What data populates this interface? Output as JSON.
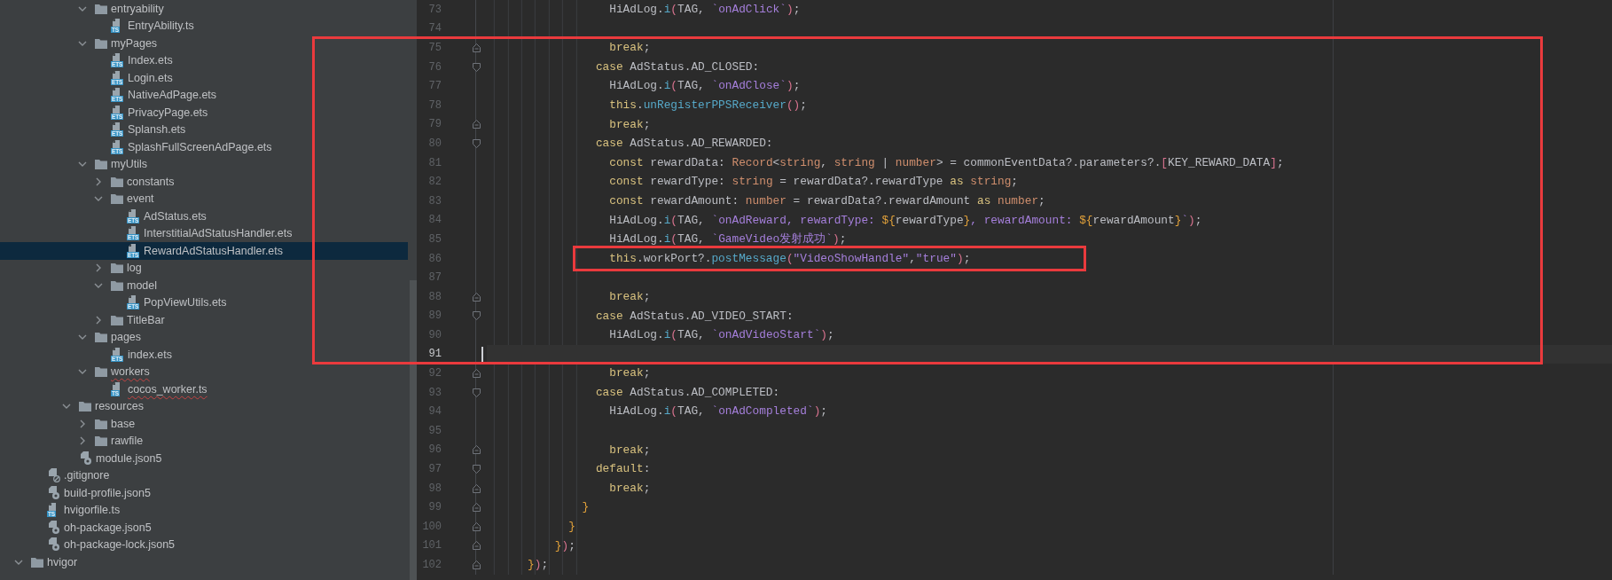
{
  "project_tree": {
    "items": [
      {
        "children": [
          {
            "children": [
              {
                "children": [
                  {
                    "children": [
                      {
                        "label": "entryability",
                        "kind": "folder",
                        "expanded": true,
                        "selected": false,
                        "misspelled": false,
                        "children": [
                          {
                            "label": "EntryAbility.ts",
                            "kind": "code_file",
                            "badge": "TS",
                            "selected": false,
                            "misspelled": false
                          }
                        ]
                      },
                      {
                        "label": "myPages",
                        "kind": "folder",
                        "expanded": true,
                        "selected": false,
                        "misspelled": false,
                        "children": [
                          {
                            "label": "Index.ets",
                            "kind": "code_file",
                            "badge": "ETS",
                            "selected": false,
                            "misspelled": false
                          },
                          {
                            "label": "Login.ets",
                            "kind": "code_file",
                            "badge": "ETS",
                            "selected": false,
                            "misspelled": false
                          },
                          {
                            "label": "NativeAdPage.ets",
                            "kind": "code_file",
                            "badge": "ETS",
                            "selected": false,
                            "misspelled": false
                          },
                          {
                            "label": "PrivacyPage.ets",
                            "kind": "code_file",
                            "badge": "ETS",
                            "selected": false,
                            "misspelled": false
                          },
                          {
                            "label": "Splansh.ets",
                            "kind": "code_file",
                            "badge": "ETS",
                            "selected": false,
                            "misspelled": false
                          },
                          {
                            "label": "SplashFullScreenAdPage.ets",
                            "kind": "code_file",
                            "badge": "ETS",
                            "selected": false,
                            "misspelled": false
                          }
                        ]
                      },
                      {
                        "label": "myUtils",
                        "kind": "folder",
                        "expanded": true,
                        "selected": false,
                        "misspelled": false,
                        "children": [
                          {
                            "label": "constants",
                            "kind": "folder",
                            "expanded": false,
                            "selected": false,
                            "misspelled": false
                          },
                          {
                            "label": "event",
                            "kind": "folder",
                            "expanded": true,
                            "selected": false,
                            "misspelled": false,
                            "children": [
                              {
                                "label": "AdStatus.ets",
                                "kind": "code_file",
                                "badge": "ETS",
                                "selected": false,
                                "misspelled": false
                              },
                              {
                                "label": "InterstitialAdStatusHandler.ets",
                                "kind": "code_file",
                                "badge": "ETS",
                                "selected": false,
                                "misspelled": false
                              },
                              {
                                "label": "RewardAdStatusHandler.ets",
                                "kind": "code_file",
                                "badge": "ETS",
                                "selected": true,
                                "misspelled": false
                              }
                            ]
                          },
                          {
                            "label": "log",
                            "kind": "folder",
                            "expanded": false,
                            "selected": false,
                            "misspelled": false
                          },
                          {
                            "label": "model",
                            "kind": "folder",
                            "expanded": true,
                            "selected": false,
                            "misspelled": false,
                            "children": [
                              {
                                "label": "PopViewUtils.ets",
                                "kind": "code_file",
                                "badge": "ETS",
                                "selected": false,
                                "misspelled": false
                              }
                            ]
                          },
                          {
                            "label": "TitleBar",
                            "kind": "folder",
                            "expanded": false,
                            "selected": false,
                            "misspelled": false
                          }
                        ]
                      },
                      {
                        "label": "pages",
                        "kind": "folder",
                        "expanded": true,
                        "selected": false,
                        "misspelled": false,
                        "children": [
                          {
                            "label": "index.ets",
                            "kind": "code_file",
                            "badge": "ETS",
                            "selected": false,
                            "misspelled": false
                          }
                        ]
                      },
                      {
                        "label": "workers",
                        "kind": "folder",
                        "expanded": true,
                        "selected": false,
                        "misspelled": true,
                        "children": [
                          {
                            "label": "cocos_worker.ts",
                            "kind": "code_file",
                            "badge": "TS",
                            "selected": false,
                            "misspelled": true
                          }
                        ]
                      }
                    ]
                  },
                  {
                    "label": "resources",
                    "kind": "folder",
                    "expanded": true,
                    "selected": false,
                    "misspelled": false,
                    "children": [
                      {
                        "label": "base",
                        "kind": "folder",
                        "expanded": false,
                        "selected": false,
                        "misspelled": false
                      },
                      {
                        "label": "rawfile",
                        "kind": "folder",
                        "expanded": false,
                        "selected": false,
                        "misspelled": false
                      }
                    ]
                  },
                  {
                    "label": "module.json5",
                    "kind": "config_file",
                    "selected": false,
                    "misspelled": false
                  }
                ]
              }
            ]
          },
          {
            "label": ".gitignore",
            "kind": "ignore_file",
            "selected": false,
            "misspelled": false
          },
          {
            "label": "build-profile.json5",
            "kind": "config_file",
            "selected": false,
            "misspelled": false
          },
          {
            "label": "hvigorfile.ts",
            "kind": "code_file",
            "badge": "TS",
            "selected": false,
            "misspelled": false
          },
          {
            "label": "oh-package.json5",
            "kind": "config_file",
            "selected": false,
            "misspelled": false
          },
          {
            "label": "oh-package-lock.json5",
            "kind": "config_file",
            "selected": false,
            "misspelled": false
          }
        ]
      },
      {
        "label": "hvigor",
        "kind": "folder",
        "expanded": true,
        "selected": false,
        "misspelled": false
      }
    ]
  },
  "editor": {
    "lines": [
      {
        "number": "73",
        "kind": "code",
        "current": false,
        "tokens": [
          {
            "text": "                  HiAdLog.",
            "kind": "plain"
          },
          {
            "text": "i",
            "kind": "call"
          },
          {
            "text": "(",
            "kind": "bracket"
          },
          {
            "text": "TAG, ",
            "kind": "plain"
          },
          {
            "text": "`onAdClick`",
            "kind": "string"
          },
          {
            "text": ")",
            "kind": "bracket"
          },
          {
            "text": ";",
            "kind": "plain"
          }
        ]
      },
      {
        "number": "74",
        "kind": "code",
        "current": false
      },
      {
        "number": "75",
        "kind": "fold_end",
        "current": false,
        "tokens": [
          {
            "text": "                  break",
            "kind": "keyword"
          },
          {
            "text": ";",
            "kind": "plain"
          }
        ]
      },
      {
        "number": "76",
        "kind": "fold_start",
        "current": false,
        "tokens": [
          {
            "text": "                case",
            "kind": "keyword"
          },
          {
            "text": " AdStatus.AD_CLOSED:",
            "kind": "plain"
          }
        ]
      },
      {
        "number": "77",
        "kind": "code",
        "current": false,
        "tokens": [
          {
            "text": "                  HiAdLog.",
            "kind": "plain"
          },
          {
            "text": "i",
            "kind": "call"
          },
          {
            "text": "(",
            "kind": "bracket"
          },
          {
            "text": "TAG, ",
            "kind": "plain"
          },
          {
            "text": "`onAdClose`",
            "kind": "string"
          },
          {
            "text": ")",
            "kind": "bracket"
          },
          {
            "text": ";",
            "kind": "plain"
          }
        ]
      },
      {
        "number": "78",
        "kind": "code",
        "current": false,
        "tokens": [
          {
            "text": "                  this",
            "kind": "keyword"
          },
          {
            "text": ".",
            "kind": "plain"
          },
          {
            "text": "unRegisterPPSReceiver",
            "kind": "call"
          },
          {
            "text": "()",
            "kind": "bracket"
          },
          {
            "text": ";",
            "kind": "plain"
          }
        ]
      },
      {
        "number": "79",
        "kind": "fold_end",
        "current": false,
        "tokens": [
          {
            "text": "                  break",
            "kind": "keyword"
          },
          {
            "text": ";",
            "kind": "plain"
          }
        ]
      },
      {
        "number": "80",
        "kind": "fold_start",
        "current": false,
        "tokens": [
          {
            "text": "                case",
            "kind": "keyword"
          },
          {
            "text": " AdStatus.AD_REWARDED:",
            "kind": "plain"
          }
        ]
      },
      {
        "number": "81",
        "kind": "code",
        "current": false,
        "tokens": [
          {
            "text": "                  const",
            "kind": "keyword"
          },
          {
            "text": " rewardData: ",
            "kind": "plain"
          },
          {
            "text": "Record",
            "kind": "type"
          },
          {
            "text": "<",
            "kind": "plain"
          },
          {
            "text": "string",
            "kind": "type"
          },
          {
            "text": ", ",
            "kind": "plain"
          },
          {
            "text": "string",
            "kind": "type"
          },
          {
            "text": " | ",
            "kind": "plain"
          },
          {
            "text": "number",
            "kind": "type"
          },
          {
            "text": "> = commonEventData?.parameters?.",
            "kind": "plain"
          },
          {
            "text": "[",
            "kind": "bracket"
          },
          {
            "text": "KEY_REWARD_DATA",
            "kind": "plain"
          },
          {
            "text": "]",
            "kind": "bracket"
          },
          {
            "text": ";",
            "kind": "plain"
          }
        ]
      },
      {
        "number": "82",
        "kind": "code",
        "current": false,
        "tokens": [
          {
            "text": "                  const",
            "kind": "keyword"
          },
          {
            "text": " rewardType: ",
            "kind": "plain"
          },
          {
            "text": "string",
            "kind": "type"
          },
          {
            "text": " = rewardData?.rewardType ",
            "kind": "plain"
          },
          {
            "text": "as ",
            "kind": "keyword"
          },
          {
            "text": "string",
            "kind": "type"
          },
          {
            "text": ";",
            "kind": "plain"
          }
        ]
      },
      {
        "number": "83",
        "kind": "code",
        "current": false,
        "tokens": [
          {
            "text": "                  const",
            "kind": "keyword"
          },
          {
            "text": " rewardAmount: ",
            "kind": "plain"
          },
          {
            "text": "number",
            "kind": "type"
          },
          {
            "text": " = rewardData?.rewardAmount ",
            "kind": "plain"
          },
          {
            "text": "as ",
            "kind": "keyword"
          },
          {
            "text": "number",
            "kind": "type"
          },
          {
            "text": ";",
            "kind": "plain"
          }
        ]
      },
      {
        "number": "84",
        "kind": "code",
        "current": false,
        "tokens": [
          {
            "text": "                  HiAdLog.",
            "kind": "plain"
          },
          {
            "text": "i",
            "kind": "call"
          },
          {
            "text": "(",
            "kind": "bracket"
          },
          {
            "text": "TAG, ",
            "kind": "plain"
          },
          {
            "text": "`onAdReward, rewardType: ",
            "kind": "string"
          },
          {
            "text": "${",
            "kind": "brace"
          },
          {
            "text": "rewardType",
            "kind": "plain"
          },
          {
            "text": "}",
            "kind": "brace"
          },
          {
            "text": ", rewardAmount: ",
            "kind": "string"
          },
          {
            "text": "${",
            "kind": "brace"
          },
          {
            "text": "rewardAmount",
            "kind": "plain"
          },
          {
            "text": "}",
            "kind": "brace"
          },
          {
            "text": "`",
            "kind": "string"
          },
          {
            "text": ")",
            "kind": "bracket"
          },
          {
            "text": ";",
            "kind": "plain"
          }
        ]
      },
      {
        "number": "85",
        "kind": "code",
        "current": false,
        "tokens": [
          {
            "text": "                  HiAdLog.",
            "kind": "plain"
          },
          {
            "text": "i",
            "kind": "call"
          },
          {
            "text": "(",
            "kind": "bracket"
          },
          {
            "text": "TAG, ",
            "kind": "plain"
          },
          {
            "text": "`GameVideo发射成功`",
            "kind": "string"
          },
          {
            "text": ")",
            "kind": "bracket"
          },
          {
            "text": ";",
            "kind": "plain"
          }
        ]
      },
      {
        "number": "86",
        "kind": "code",
        "current": false,
        "tokens": [
          {
            "text": "                  this",
            "kind": "keyword"
          },
          {
            "text": ".workPort?.",
            "kind": "plain"
          },
          {
            "text": "postMessage",
            "kind": "call"
          },
          {
            "text": "(",
            "kind": "bracket"
          },
          {
            "text": "\"VideoShowHandle\"",
            "kind": "string"
          },
          {
            "text": ",",
            "kind": "plain"
          },
          {
            "text": "\"true\"",
            "kind": "string"
          },
          {
            "text": ")",
            "kind": "bracket"
          },
          {
            "text": ";",
            "kind": "plain"
          }
        ]
      },
      {
        "number": "87",
        "kind": "code",
        "current": false
      },
      {
        "number": "88",
        "kind": "fold_end",
        "current": false,
        "tokens": [
          {
            "text": "                  break",
            "kind": "keyword"
          },
          {
            "text": ";",
            "kind": "plain"
          }
        ]
      },
      {
        "number": "89",
        "kind": "fold_start",
        "current": false,
        "tokens": [
          {
            "text": "                case",
            "kind": "keyword"
          },
          {
            "text": " AdStatus.AD_VIDEO_START:",
            "kind": "plain"
          }
        ]
      },
      {
        "number": "90",
        "kind": "code",
        "current": false,
        "tokens": [
          {
            "text": "                  HiAdLog.",
            "kind": "plain"
          },
          {
            "text": "i",
            "kind": "call"
          },
          {
            "text": "(",
            "kind": "bracket"
          },
          {
            "text": "TAG, ",
            "kind": "plain"
          },
          {
            "text": "`onAdVideoStart`",
            "kind": "string"
          },
          {
            "text": ")",
            "kind": "bracket"
          },
          {
            "text": ";",
            "kind": "plain"
          }
        ]
      },
      {
        "number": "91",
        "kind": "code",
        "current": true
      },
      {
        "number": "92",
        "kind": "fold_end",
        "current": false,
        "tokens": [
          {
            "text": "                  break",
            "kind": "keyword"
          },
          {
            "text": ";",
            "kind": "plain"
          }
        ]
      },
      {
        "number": "93",
        "kind": "fold_start",
        "current": false,
        "tokens": [
          {
            "text": "                case",
            "kind": "keyword"
          },
          {
            "text": " AdStatus.AD_COMPLETED:",
            "kind": "plain"
          }
        ]
      },
      {
        "number": "94",
        "kind": "code",
        "current": false,
        "tokens": [
          {
            "text": "                  HiAdLog.",
            "kind": "plain"
          },
          {
            "text": "i",
            "kind": "call"
          },
          {
            "text": "(",
            "kind": "bracket"
          },
          {
            "text": "TAG, ",
            "kind": "plain"
          },
          {
            "text": "`onAdCompleted`",
            "kind": "string"
          },
          {
            "text": ")",
            "kind": "bracket"
          },
          {
            "text": ";",
            "kind": "plain"
          }
        ]
      },
      {
        "number": "95",
        "kind": "code",
        "current": false
      },
      {
        "number": "96",
        "kind": "fold_end",
        "current": false,
        "tokens": [
          {
            "text": "                  break",
            "kind": "keyword"
          },
          {
            "text": ";",
            "kind": "plain"
          }
        ]
      },
      {
        "number": "97",
        "kind": "fold_start",
        "current": false,
        "tokens": [
          {
            "text": "                default",
            "kind": "keyword"
          },
          {
            "text": ":",
            "kind": "plain"
          }
        ]
      },
      {
        "number": "98",
        "kind": "fold_end",
        "current": false,
        "tokens": [
          {
            "text": "                  break",
            "kind": "keyword"
          },
          {
            "text": ";",
            "kind": "plain"
          }
        ]
      },
      {
        "number": "99",
        "kind": "fold_end",
        "current": false,
        "tokens": [
          {
            "text": "              }",
            "kind": "brace"
          }
        ]
      },
      {
        "number": "100",
        "kind": "fold_end",
        "current": false,
        "tokens": [
          {
            "text": "            }",
            "kind": "brace"
          }
        ]
      },
      {
        "number": "101",
        "kind": "fold_end",
        "current": false,
        "tokens": [
          {
            "text": "          }",
            "kind": "brace"
          },
          {
            "text": ")",
            "kind": "bracket"
          },
          {
            "text": ";",
            "kind": "plain"
          }
        ]
      },
      {
        "number": "102",
        "kind": "fold_end",
        "current": false,
        "tokens": [
          {
            "text": "      }",
            "kind": "brace"
          },
          {
            "text": ")",
            "kind": "bracket"
          },
          {
            "text": ";",
            "kind": "plain"
          }
        ]
      }
    ]
  },
  "annotations": [
    {
      "kind": "frame"
    },
    {
      "kind": "frame"
    }
  ]
}
